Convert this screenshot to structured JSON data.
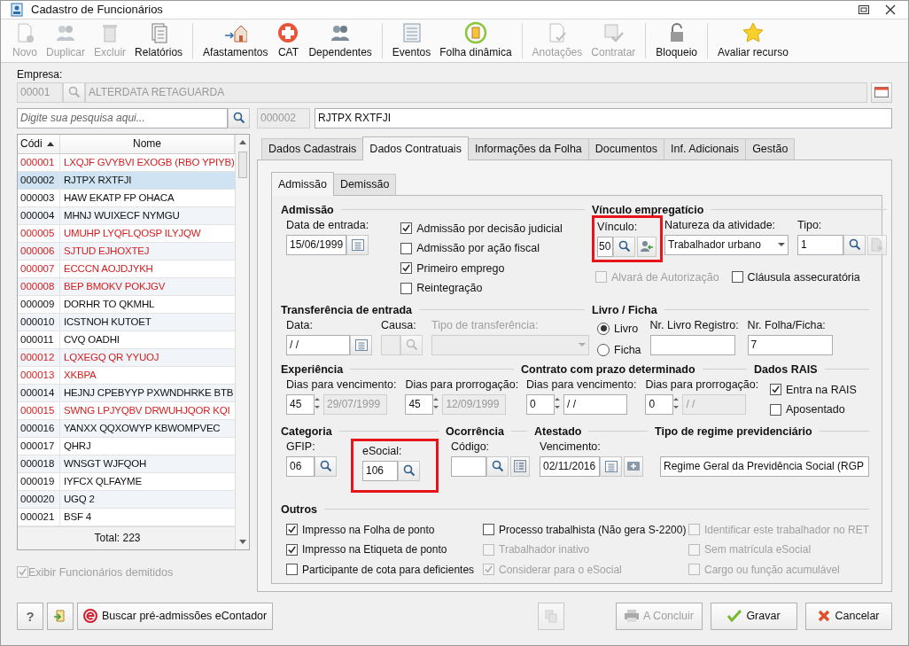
{
  "window": {
    "title": "Cadastro de Funcionários"
  },
  "toolbar": [
    {
      "label": "Novo",
      "kind": "new",
      "disabled": true,
      "separator_after": false
    },
    {
      "label": "Duplicar",
      "kind": "people",
      "disabled": true,
      "separator_after": false
    },
    {
      "label": "Excluir",
      "kind": "trash",
      "disabled": true,
      "separator_after": false
    },
    {
      "label": "Relatórios",
      "kind": "report",
      "disabled": false,
      "separator_after": true
    },
    {
      "label": "Afastamentos",
      "kind": "house",
      "disabled": false,
      "separator_after": false
    },
    {
      "label": "CAT",
      "kind": "cross",
      "disabled": false,
      "separator_after": false
    },
    {
      "label": "Dependentes",
      "kind": "people",
      "disabled": false,
      "separator_after": true
    },
    {
      "label": "Eventos",
      "kind": "list",
      "disabled": false,
      "separator_after": false
    },
    {
      "label": "Folha dinâmica",
      "kind": "calc",
      "disabled": false,
      "separator_after": true
    },
    {
      "label": "Anotações",
      "kind": "note",
      "disabled": true,
      "separator_after": false
    },
    {
      "label": "Contratar",
      "kind": "hire",
      "disabled": true,
      "separator_after": true
    },
    {
      "label": "Bloqueio",
      "kind": "lock",
      "disabled": false,
      "separator_after": true
    },
    {
      "label": "Avaliar recurso",
      "kind": "star",
      "disabled": false,
      "separator_after": false
    }
  ],
  "company": {
    "label": "Empresa:",
    "code": "00001",
    "name": "ALTERDATA RETAGUARDA"
  },
  "search": {
    "placeholder": "Digite sua pesquisa aqui..."
  },
  "employee": {
    "code": "000002",
    "name": "RJTPX RXTFJI"
  },
  "list": {
    "columns": [
      "Códi",
      "Nome"
    ],
    "total": "Total: 223",
    "rows": [
      {
        "code": "000001",
        "name": "LXQJF GVYBVI EXOGB (RBO YPIYB)",
        "dismissed": true,
        "selected": false
      },
      {
        "code": "000002",
        "name": "RJTPX RXTFJI",
        "dismissed": false,
        "selected": true
      },
      {
        "code": "000003",
        "name": "HAW EKATP FP OHACA",
        "dismissed": false,
        "selected": false
      },
      {
        "code": "000004",
        "name": "MHNJ WUIXECF NYMGU",
        "dismissed": false,
        "selected": false
      },
      {
        "code": "000005",
        "name": "UMUHP LYQFLQOSP ILYJQW",
        "dismissed": true,
        "selected": false
      },
      {
        "code": "000006",
        "name": "SJTUD EJHOXTEJ",
        "dismissed": true,
        "selected": false
      },
      {
        "code": "000007",
        "name": "ECCCN  AOJDJYKH",
        "dismissed": true,
        "selected": false
      },
      {
        "code": "000008",
        "name": "BEP BMOKV POKJGV",
        "dismissed": true,
        "selected": false
      },
      {
        "code": "000009",
        "name": "DORHR TO QKMHL",
        "dismissed": false,
        "selected": false
      },
      {
        "code": "000010",
        "name": "ICSTNOH KUTOET",
        "dismissed": false,
        "selected": false
      },
      {
        "code": "000011",
        "name": "CVQ OADHI",
        "dismissed": false,
        "selected": false
      },
      {
        "code": "000012",
        "name": "LQXEGQ QR YYUOJ",
        "dismissed": true,
        "selected": false
      },
      {
        "code": "000013",
        "name": "XKBPA",
        "dismissed": true,
        "selected": false
      },
      {
        "code": "000014",
        "name": "HEJNJ CPEBYYP PXWNDHRKE BTB",
        "dismissed": false,
        "selected": false
      },
      {
        "code": "000015",
        "name": "SWNG LPJYQBV DRWUHJQOR KQI",
        "dismissed": true,
        "selected": false
      },
      {
        "code": "000016",
        "name": "YANXX QQXOWYP KBWOMPVEC",
        "dismissed": false,
        "selected": false
      },
      {
        "code": "000017",
        "name": "QHRJ",
        "dismissed": false,
        "selected": false
      },
      {
        "code": "000018",
        "name": "WNSGT WJFQOH",
        "dismissed": false,
        "selected": false
      },
      {
        "code": "000019",
        "name": "IYFCX QLFAYME",
        "dismissed": false,
        "selected": false
      },
      {
        "code": "000020",
        "name": "UGQ 2",
        "dismissed": false,
        "selected": false
      },
      {
        "code": "000021",
        "name": "BSF 4",
        "dismissed": false,
        "selected": false
      }
    ]
  },
  "show_dismissed": {
    "label": "Exibir Funcionários demitidos",
    "checked": true,
    "disabled": true
  },
  "tabs": [
    {
      "label": "Dados Cadastrais",
      "selected": false
    },
    {
      "label": "Dados Contratuais",
      "selected": true
    },
    {
      "label": "Informações da Folha",
      "selected": false
    },
    {
      "label": "Documentos",
      "selected": false
    },
    {
      "label": "Inf. Adicionais",
      "selected": false
    },
    {
      "label": "Gestão",
      "selected": false
    }
  ],
  "subtabs": [
    {
      "label": "Admissão",
      "selected": true
    },
    {
      "label": "Demissão",
      "selected": false
    }
  ],
  "admissao": {
    "title": "Admissão",
    "date": {
      "label": "Data de entrada:",
      "value": "15/06/1999"
    },
    "options": [
      {
        "label": "Admissão por decisão judicial",
        "checked": true
      },
      {
        "label": "Admissão por ação fiscal",
        "checked": false
      },
      {
        "label": "Primeiro emprego",
        "checked": true
      },
      {
        "label": "Reintegração",
        "checked": false
      }
    ]
  },
  "vinculo": {
    "title": "Vínculo empregatício",
    "vinculo": {
      "label": "Vínculo:",
      "value": "50",
      "highlighted": true
    },
    "natureza": {
      "label": "Natureza da atividade:",
      "value": "Trabalhador urbano"
    },
    "tipo": {
      "label": "Tipo:",
      "value": "1"
    },
    "options": [
      {
        "label": "Alvará de Autorização",
        "checked": false,
        "disabled": true
      },
      {
        "label": "Cláusula assecuratória",
        "checked": false,
        "disabled": false
      }
    ]
  },
  "transferencia": {
    "title": "Transferência de entrada",
    "data": {
      "label": "Data:",
      "value": "/ /"
    },
    "causa": {
      "label": "Causa:"
    },
    "tipo": {
      "label": "Tipo de transferência:"
    }
  },
  "livro": {
    "title": "Livro / Ficha",
    "radios": [
      {
        "label": "Livro",
        "selected": true
      },
      {
        "label": "Ficha",
        "selected": false
      }
    ],
    "registro": {
      "label": "Nr. Livro Registro:"
    },
    "folha": {
      "label": "Nr. Folha/Ficha:",
      "value": "7"
    }
  },
  "experiencia": {
    "title": "Experiência",
    "fields": [
      {
        "label": "Dias para vencimento:",
        "value": "45",
        "date": "29/07/1999",
        "date_disabled": true
      },
      {
        "label": "Dias para prorrogação:",
        "value": "45",
        "date": "12/09/1999",
        "date_disabled": true
      }
    ]
  },
  "contrato": {
    "title": "Contrato com prazo determinado",
    "fields": [
      {
        "label": "Dias para vencimento:",
        "value": "0",
        "date": "/ /",
        "date_disabled": false
      },
      {
        "label": "Dias para prorrogação:",
        "value": "0",
        "date": "/ /",
        "date_disabled": true
      }
    ]
  },
  "rais": {
    "title": "Dados RAIS",
    "options": [
      {
        "label": "Entra na RAIS",
        "checked": true
      },
      {
        "label": "Aposentado",
        "checked": false
      }
    ]
  },
  "categoria": {
    "title": "Categoria",
    "gfip": {
      "label": "GFIP:",
      "value": "06"
    },
    "esocial": {
      "label": "eSocial:",
      "value": "106",
      "highlighted": true
    }
  },
  "ocorrencia": {
    "title": "Ocorrência",
    "codigo": {
      "label": "Código:"
    }
  },
  "atestado": {
    "title": "Atestado",
    "vencimento": {
      "label": "Vencimento:",
      "value": "02/11/2016"
    }
  },
  "regime": {
    "title": "Tipo de regime previdenciário",
    "value": "Regime Geral da Previdência Social (RGP"
  },
  "outros": {
    "title": "Outros",
    "options": [
      {
        "label": "Impresso na Folha de ponto",
        "checked": true,
        "disabled": false
      },
      {
        "label": "Processo trabalhista (Não gera S-2200)",
        "checked": false,
        "disabled": false
      },
      {
        "label": "Identificar este trabalhador no RET",
        "checked": false,
        "disabled": true
      },
      {
        "label": "Impresso na Etiqueta de ponto",
        "checked": true,
        "disabled": false
      },
      {
        "label": "Trabalhador inativo",
        "checked": false,
        "disabled": true
      },
      {
        "label": "Sem matrícula eSocial",
        "checked": false,
        "disabled": true
      },
      {
        "label": "Participante de cota para deficientes",
        "checked": false,
        "disabled": false
      },
      {
        "label": "Considerar para o eSocial",
        "checked": true,
        "disabled": true
      },
      {
        "label": "Cargo ou função acumulável",
        "checked": false,
        "disabled": true
      }
    ]
  },
  "footer": {
    "help": "?",
    "import_label": "Buscar pré-admissões eContador",
    "buttons": [
      {
        "label": "A Concluir",
        "kind": "print",
        "disabled": true
      },
      {
        "label": "Gravar",
        "kind": "check",
        "disabled": false
      },
      {
        "label": "Cancelar",
        "kind": "cancel",
        "disabled": false
      }
    ]
  }
}
